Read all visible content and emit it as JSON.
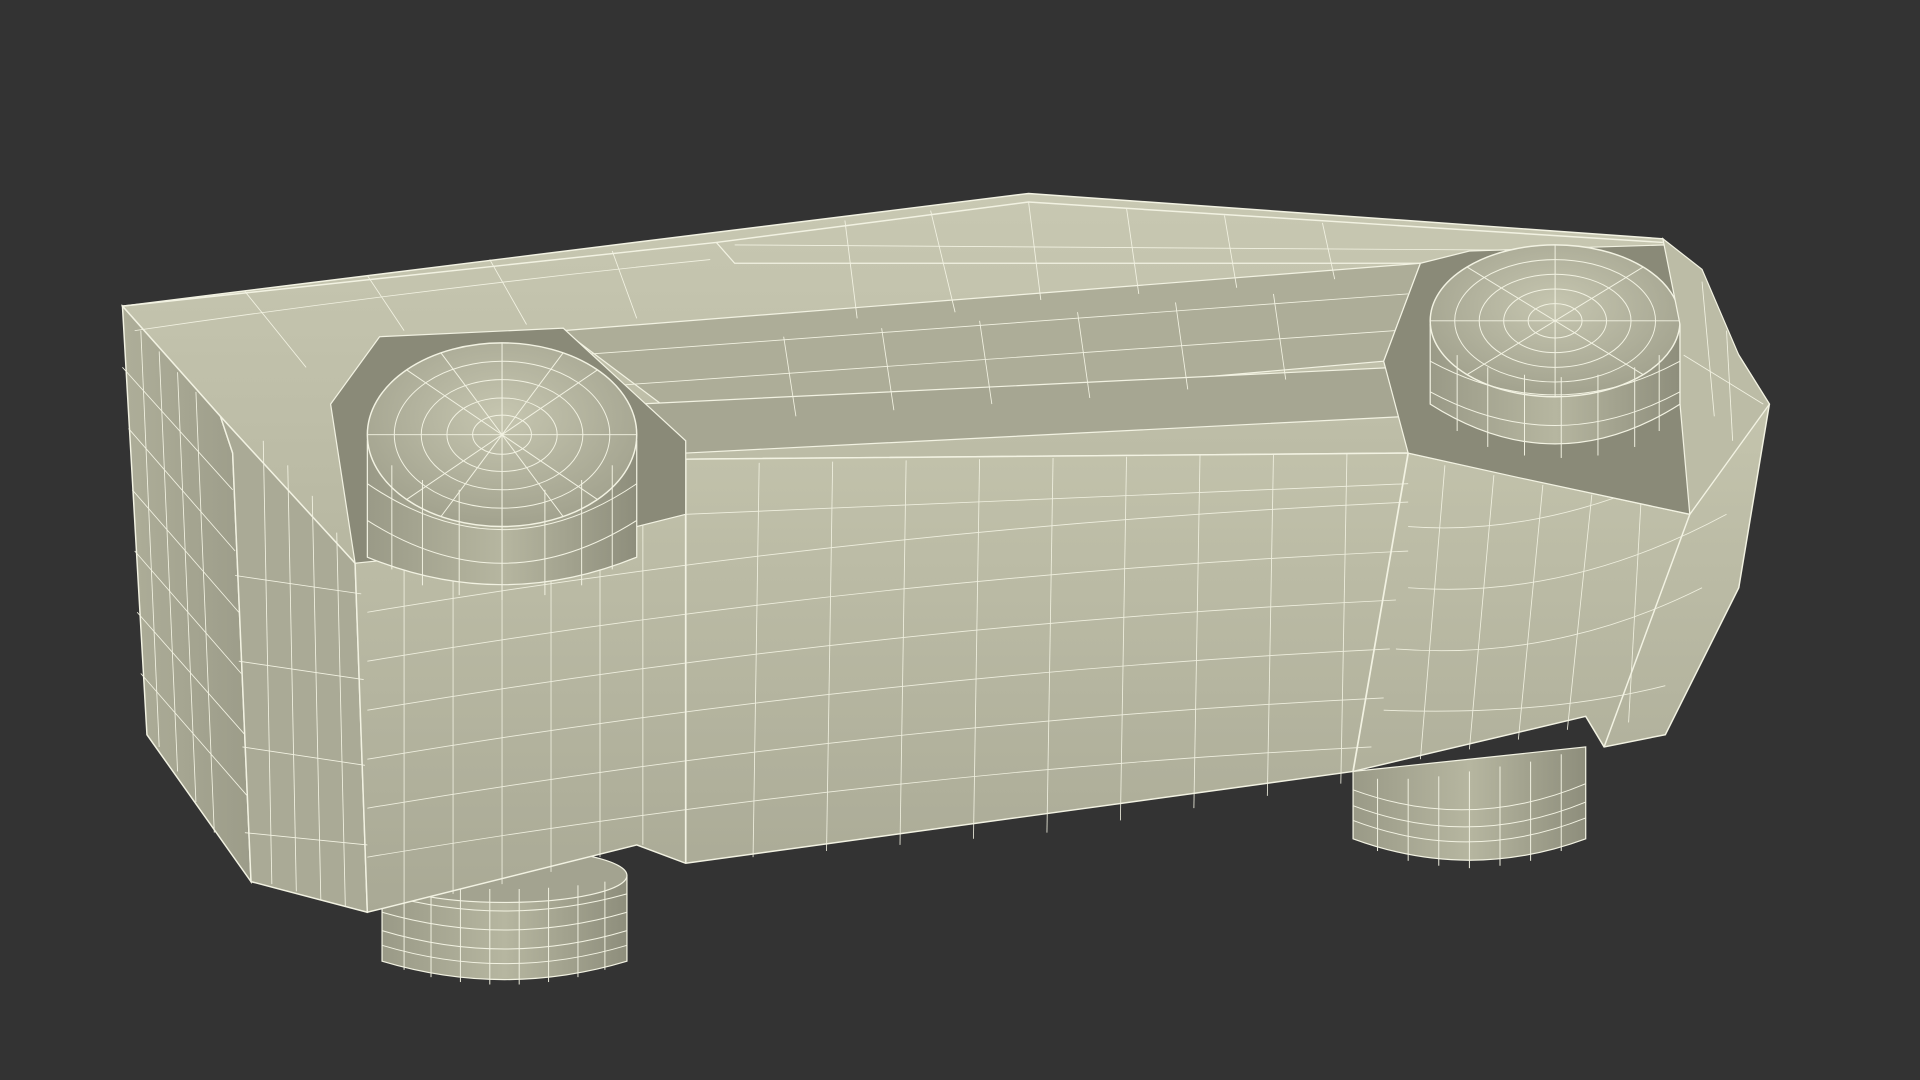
{
  "viewport": {
    "background": "#333333",
    "subject": "wireframe-vehicle-model"
  },
  "model": {
    "surface_color": "#b3b39c",
    "surface_light": "#c2c2ab",
    "surface_dark": "#8f8f7c",
    "shadow_color": "#6e6e60",
    "wire_color": "#f2f2e2"
  }
}
